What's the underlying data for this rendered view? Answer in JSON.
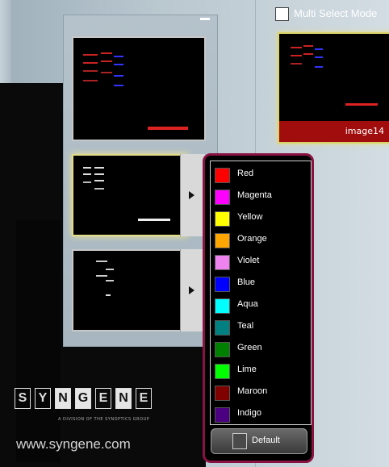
{
  "multi_select": {
    "label": "Multi Select Mode",
    "checked": false
  },
  "preview_card": {
    "label": "image14",
    "label_bar_color": "#a10d0d"
  },
  "color_menu": {
    "items": [
      {
        "label": "Red",
        "color": "#ff0000"
      },
      {
        "label": "Magenta",
        "color": "#ff00ff"
      },
      {
        "label": "Yellow",
        "color": "#ffff00"
      },
      {
        "label": "Orange",
        "color": "#ffa500"
      },
      {
        "label": "Violet",
        "color": "#ee82ee"
      },
      {
        "label": "Blue",
        "color": "#0000ff"
      },
      {
        "label": "Aqua",
        "color": "#00ffff"
      },
      {
        "label": "Teal",
        "color": "#008080"
      },
      {
        "label": "Green",
        "color": "#008000"
      },
      {
        "label": "Lime",
        "color": "#00ff00"
      },
      {
        "label": "Maroon",
        "color": "#800000"
      },
      {
        "label": "Indigo",
        "color": "#4b0082"
      }
    ],
    "default_button": {
      "label": "Default"
    }
  },
  "logo": {
    "letters": [
      "S",
      "Y",
      "N",
      "G",
      "E",
      "N",
      "E"
    ],
    "tagline": "A DIVISION OF THE SYNOPTICS GROUP",
    "website": "www.syngene.com"
  },
  "thumbnails": [
    {
      "name": "thumbnail-1",
      "selected": false
    },
    {
      "name": "thumbnail-2",
      "selected": true,
      "has_arrow": true
    },
    {
      "name": "thumbnail-3",
      "selected": false,
      "has_arrow": true
    }
  ]
}
